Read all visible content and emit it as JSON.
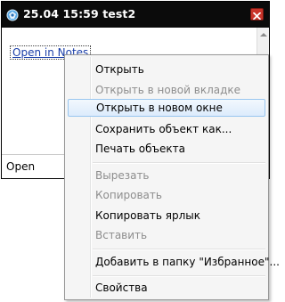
{
  "window": {
    "title": "25.04 15:59 test2",
    "link_text": "Open in Notes",
    "status_text": "Open"
  },
  "context_menu": {
    "items": [
      {
        "label": "Открыть",
        "disabled": false
      },
      {
        "label": "Открыть в новой вкладке",
        "disabled": true
      },
      {
        "label": "Открыть в новом окне",
        "disabled": false,
        "highlighted": true
      },
      {
        "label": "Сохранить объект как...",
        "disabled": false
      },
      {
        "label": "Печать объекта",
        "disabled": false
      },
      {
        "label": "Вырезать",
        "disabled": true
      },
      {
        "label": "Копировать",
        "disabled": true
      },
      {
        "label": "Копировать ярлык",
        "disabled": false
      },
      {
        "label": "Вставить",
        "disabled": true
      },
      {
        "label": "Добавить в папку \"Избранное\"...",
        "disabled": false
      },
      {
        "label": "Свойства",
        "disabled": false
      }
    ]
  },
  "colors": {
    "titlebar": "#0b0b0b",
    "close_button": "#c9342a",
    "link": "#1a3ea8",
    "disabled_text": "#8d8d8d",
    "highlight_border": "#99c6ef"
  },
  "icons": {
    "app": "lotus-notes-icon",
    "close": "close-icon"
  }
}
